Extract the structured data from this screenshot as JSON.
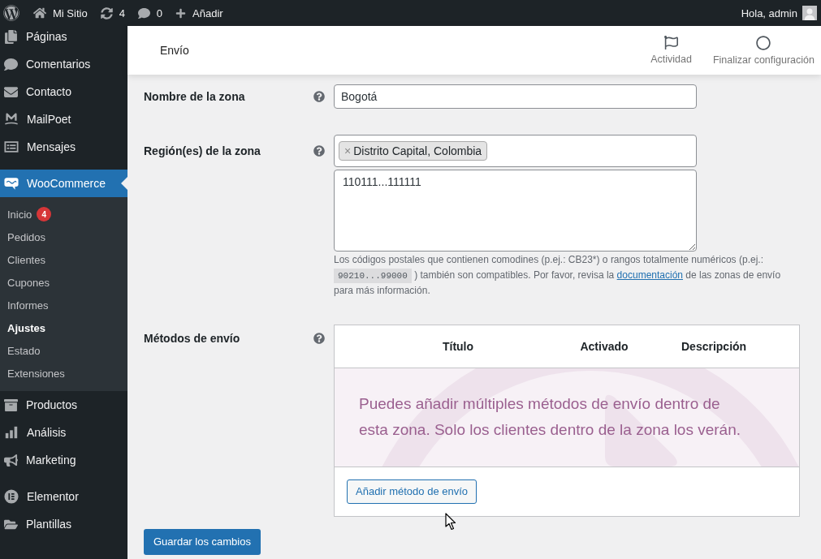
{
  "admin_bar": {
    "site_name": "Mi Sitio",
    "updates": "4",
    "comments": "0",
    "new_label": "Añadir",
    "greeting": "Hola, admin"
  },
  "sidebar": {
    "sections": [
      {
        "items": [
          {
            "label": "Páginas",
            "selected": false
          },
          {
            "label": "Comentarios",
            "selected": false
          },
          {
            "label": "Contacto",
            "selected": false
          },
          {
            "label": "MailPoet",
            "selected": false
          },
          {
            "label": "Mensajes",
            "selected": false
          }
        ]
      },
      {
        "items": [
          {
            "label": "WooCommerce",
            "selected": true,
            "children": [
              {
                "label": "Inicio",
                "badge": "4",
                "selected": false
              },
              {
                "label": "Pedidos",
                "selected": false
              },
              {
                "label": "Clientes",
                "selected": false
              },
              {
                "label": "Cupones",
                "selected": false
              },
              {
                "label": "Informes",
                "selected": false
              },
              {
                "label": "Ajustes",
                "selected": true
              },
              {
                "label": "Estado",
                "selected": false
              },
              {
                "label": "Extensiones",
                "selected": false
              }
            ]
          },
          {
            "label": "Productos",
            "selected": false
          },
          {
            "label": "Análisis",
            "selected": false
          },
          {
            "label": "Marketing",
            "selected": false
          }
        ]
      },
      {
        "items": [
          {
            "label": "Elementor",
            "selected": false
          },
          {
            "label": "Plantillas",
            "selected": false
          }
        ]
      }
    ]
  },
  "header": {
    "title": "Envío",
    "actions": [
      {
        "label": "Actividad"
      },
      {
        "label": "Finalizar configuración"
      }
    ]
  },
  "form": {
    "fields": [
      {
        "kind": "text",
        "label": "Nombre de la zona",
        "value": "Bogotá"
      },
      {
        "kind": "regions",
        "label": "Región(es) de la zona",
        "chips": [
          {
            "label": "Distrito Capital, Colombia",
            "remove": "×"
          }
        ],
        "postcodes": "110111...111111",
        "help": {
          "before": "Los códigos postales que contienen comodines (p.ej.: CB23*) o rangos totalmente numéricos (p.ej.: ",
          "code": "90210...99000",
          "middle": " ) también son compatibles. Por favor, revisa la ",
          "link": "documentación",
          "after": " de las zonas de envío para más información."
        }
      },
      {
        "kind": "methods",
        "label": "Métodos de envío",
        "columns": [
          "Título",
          "Activado",
          "Descripción"
        ],
        "empty_message": "Puedes añadir múltiples métodos de envío dentro de esta zona. Solo los clientes dentro de la zona los verán.",
        "add_button": "Añadir método de envío"
      }
    ],
    "save_button": "Guardar los cambios"
  }
}
